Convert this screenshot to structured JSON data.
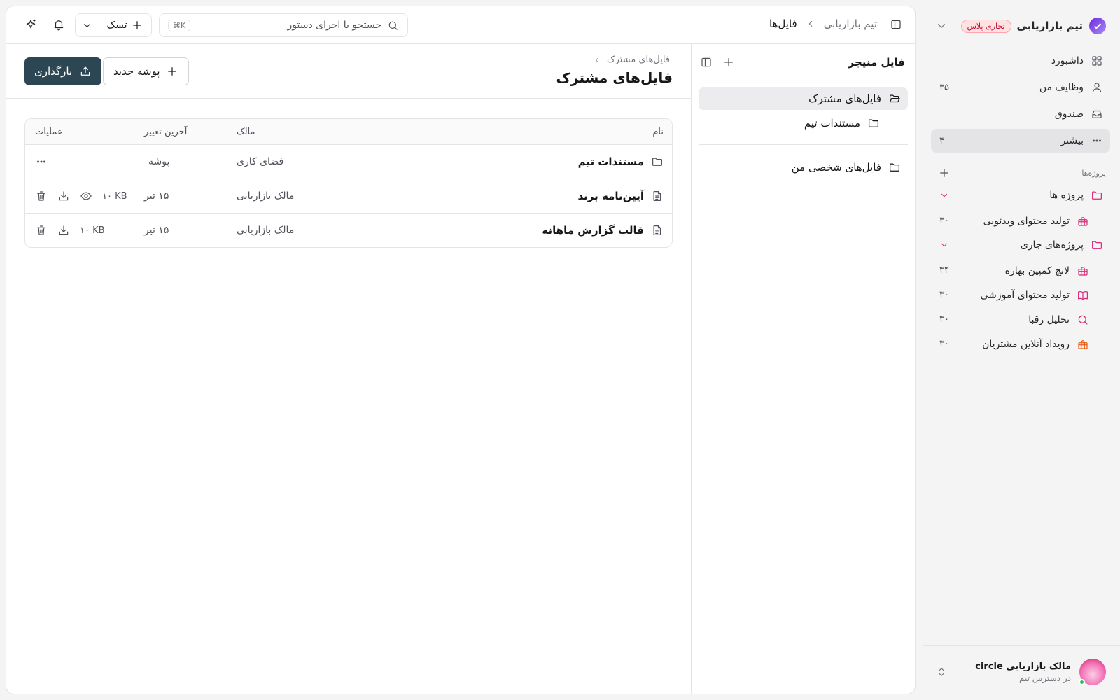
{
  "workspace": {
    "name": "تیم بازاریابی",
    "plan_badge": "تجاری پلاس"
  },
  "nav": [
    {
      "label": "داشبورد",
      "icon": "grid-icon",
      "count": ""
    },
    {
      "label": "وظایف من",
      "icon": "user-icon",
      "count": "۳۵"
    },
    {
      "label": "صندوق",
      "icon": "inbox-icon",
      "count": ""
    },
    {
      "label": "بیشتر",
      "icon": "more-icon",
      "count": "۴"
    }
  ],
  "projects_section": {
    "title": "پروژه‌ها"
  },
  "project_folders": [
    {
      "label": "پروژه ها",
      "items": [
        {
          "label": "تولید محتوای ویدئویی",
          "count": "۳۰",
          "icon": "gift-icon",
          "color": "#db2777"
        }
      ]
    },
    {
      "label": "پروژه‌های جاری",
      "items": [
        {
          "label": "لانچ کمپین بهاره",
          "count": "۳۴",
          "icon": "gift-icon",
          "color": "#db2777"
        },
        {
          "label": "تولید محتوای آموزشی",
          "count": "۳۰",
          "icon": "book-icon",
          "color": "#db2777"
        },
        {
          "label": "تحلیل رقبا",
          "count": "۳۰",
          "icon": "search-icon",
          "color": "#db2777"
        },
        {
          "label": "رویداد آنلاین مشتریان",
          "count": "۳۰",
          "icon": "gift-icon",
          "color": "#ea580c"
        }
      ]
    }
  ],
  "user": {
    "name": "مالک بازاریابی circle",
    "subtitle": "در دسترس تیم"
  },
  "topbar": {
    "breadcrumb_parent": "تیم بازاریابی",
    "breadcrumb_current": "فایل‌ها",
    "search_placeholder": "جستجو یا اجرای دستور",
    "search_shortcut": "⌘K",
    "task_button": "تسک"
  },
  "file_manager": {
    "title": "فایل منیجر",
    "tree": [
      {
        "label": "فایل‌های مشترک",
        "active": true,
        "child": false
      },
      {
        "label": "مستندات تیم",
        "active": false,
        "child": true
      }
    ],
    "personal": "فایل‌های شخصی من"
  },
  "content": {
    "sub_breadcrumb": "فایل‌های مشترک",
    "title": "فایل‌های مشترک",
    "new_folder_button": "پوشه جدید",
    "upload_button": "بارگذاری"
  },
  "table": {
    "headers": {
      "name": "نام",
      "owner": "مالک",
      "modified": "آخرین تغییر",
      "actions": "عملیات"
    },
    "rows": [
      {
        "kind": "folder",
        "name": "مستندات تیم",
        "owner": "فضای کاری",
        "modified": "پوشه",
        "size": ""
      },
      {
        "kind": "file",
        "name": "آیین‌نامه برند",
        "owner": "مالک بازاریابی",
        "modified": "۱۵ تیر",
        "size": "۱۰ KB",
        "previewable": true
      },
      {
        "kind": "file",
        "name": "قالب گزارش ماهانه",
        "owner": "مالک بازاریابی",
        "modified": "۱۵ تیر",
        "size": "۱۰ KB",
        "previewable": false
      }
    ]
  }
}
